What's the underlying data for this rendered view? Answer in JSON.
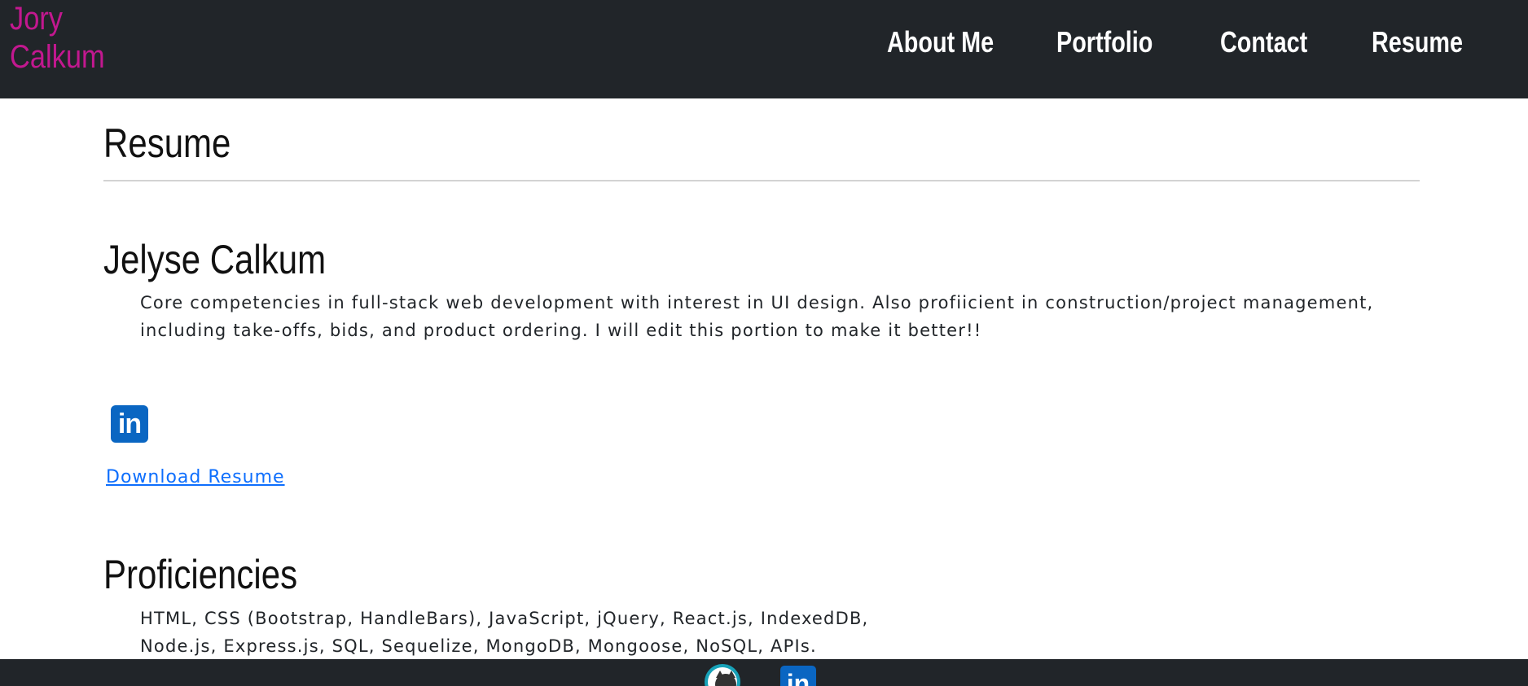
{
  "navbar": {
    "brand": "Jory\nCalkum",
    "links": [
      {
        "label": "About Me"
      },
      {
        "label": "Portfolio"
      },
      {
        "label": "Contact"
      },
      {
        "label": "Resume"
      }
    ]
  },
  "page": {
    "title": "Resume",
    "name_heading": "Jelyse Calkum",
    "summary": "Core competencies in full-stack web development with interest in UI design. Also profiicient in construction/project management, including take-offs, bids, and product ordering. I will edit this portion to make it better!!",
    "linkedin_icon": "in",
    "download_label": "Download Resume",
    "proficiencies_heading": "Proficiencies",
    "proficiencies_line1": "HTML, CSS (Bootstrap, HandleBars), JavaScript, jQuery, React.js, IndexedDB,",
    "proficiencies_line2": "Node.js, Express.js, SQL, Sequelize, MongoDB, Mongoose, NoSQL, APIs."
  },
  "footer": {
    "icons": [
      "github-icon",
      "linkedin-icon"
    ],
    "linkedin_text": "in"
  },
  "colors": {
    "navbar_bg": "#212529",
    "brand": "#c2188f",
    "link": "#0d6efd",
    "linkedin": "#0a66c2",
    "github_ring": "#17a2b8"
  }
}
